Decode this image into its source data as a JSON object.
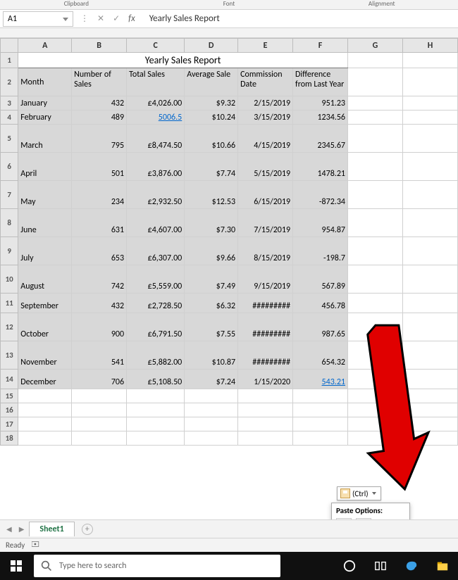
{
  "ribbon": {
    "groups": [
      "Clipboard",
      "Font",
      "Alignment"
    ]
  },
  "namebox": {
    "value": "A1"
  },
  "formula": {
    "value": "Yearly Sales Report"
  },
  "sheet": {
    "title": "Yearly Sales Report",
    "columns": [
      "A",
      "B",
      "C",
      "D",
      "E",
      "F",
      "G",
      "H"
    ],
    "headers": [
      "Month",
      "Number of Sales",
      "Total Sales",
      "Average Sale",
      "Commission Date",
      "Difference from Last Year"
    ],
    "rows": [
      {
        "month": "January",
        "num": "432",
        "total": "£4,026.00",
        "avg": "$9.32",
        "date": "2/15/2019",
        "diff": "951.23"
      },
      {
        "month": "February",
        "num": "489",
        "total": "5006.5",
        "avg": "$10.24",
        "date": "3/15/2019",
        "diff": "1234.56",
        "total_link": true
      },
      {
        "month": "March",
        "num": "795",
        "total": "£8,474.50",
        "avg": "$10.66",
        "date": "4/15/2019",
        "diff": "2345.67"
      },
      {
        "month": "April",
        "num": "501",
        "total": "£3,876.00",
        "avg": "$7.74",
        "date": "5/15/2019",
        "diff": "1478.21"
      },
      {
        "month": "May",
        "num": "234",
        "total": "£2,932.50",
        "avg": "$12.53",
        "date": "6/15/2019",
        "diff": "-872.34"
      },
      {
        "month": "June",
        "num": "631",
        "total": "£4,607.00",
        "avg": "$7.30",
        "date": "7/15/2019",
        "diff": "954.87"
      },
      {
        "month": "July",
        "num": "653",
        "total": "£6,307.00",
        "avg": "$9.66",
        "date": "8/15/2019",
        "diff": "-198.7"
      },
      {
        "month": "August",
        "num": "742",
        "total": "£5,559.00",
        "avg": "$7.49",
        "date": "9/15/2019",
        "diff": "567.89"
      },
      {
        "month": "September",
        "num": "432",
        "total": "£2,728.50",
        "avg": "$6.32",
        "date": "#########",
        "diff": "456.78"
      },
      {
        "month": "October",
        "num": "900",
        "total": "£6,791.50",
        "avg": "$7.55",
        "date": "#########",
        "diff": "987.65"
      },
      {
        "month": "November",
        "num": "541",
        "total": "£5,882.00",
        "avg": "$10.87",
        "date": "#########",
        "diff": "654.32"
      },
      {
        "month": "December",
        "num": "706",
        "total": "£5,108.50",
        "avg": "$7.24",
        "date": "1/15/2020",
        "diff": "543.21",
        "diff_link": true
      }
    ],
    "empty_rows": [
      "15",
      "16",
      "17",
      "18"
    ]
  },
  "paste": {
    "ctrl_label": "(Ctrl)",
    "popup_title": "Paste Options:"
  },
  "tabs": {
    "active": "Sheet1"
  },
  "status": {
    "text": "Ready"
  },
  "taskbar": {
    "search_placeholder": "Type here to search"
  }
}
